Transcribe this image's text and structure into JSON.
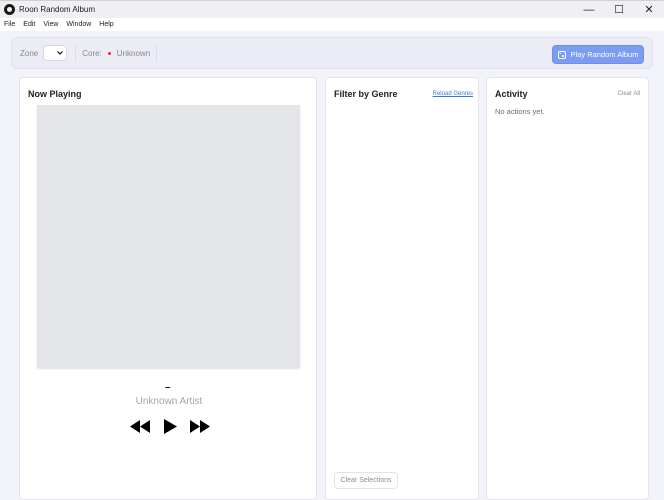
{
  "window": {
    "title": "Roon Random Album",
    "minimize_glyph": "—",
    "maximize_glyph": "☐",
    "close_glyph": "✕"
  },
  "menu": [
    "File",
    "Edit",
    "View",
    "Window",
    "Help"
  ],
  "toolbar": {
    "zone_label": "Zone",
    "zone_value": "",
    "core_label": "Core:",
    "core_status": "Unknown",
    "play_random_label": "Play Random Album"
  },
  "now_playing": {
    "title": "Now Playing",
    "track": "–",
    "artist": "Unknown Artist"
  },
  "genre": {
    "title": "Filter by Genre",
    "reload_label": "Reload Genres",
    "clear_label": "Clear Selections"
  },
  "activity": {
    "title": "Activity",
    "clear_all_label": "Clear All",
    "empty_text": "No actions yet."
  },
  "colors": {
    "accent": "#7b9cf0",
    "core_status_dot": "#e0342b",
    "link": "#3a78d0"
  }
}
